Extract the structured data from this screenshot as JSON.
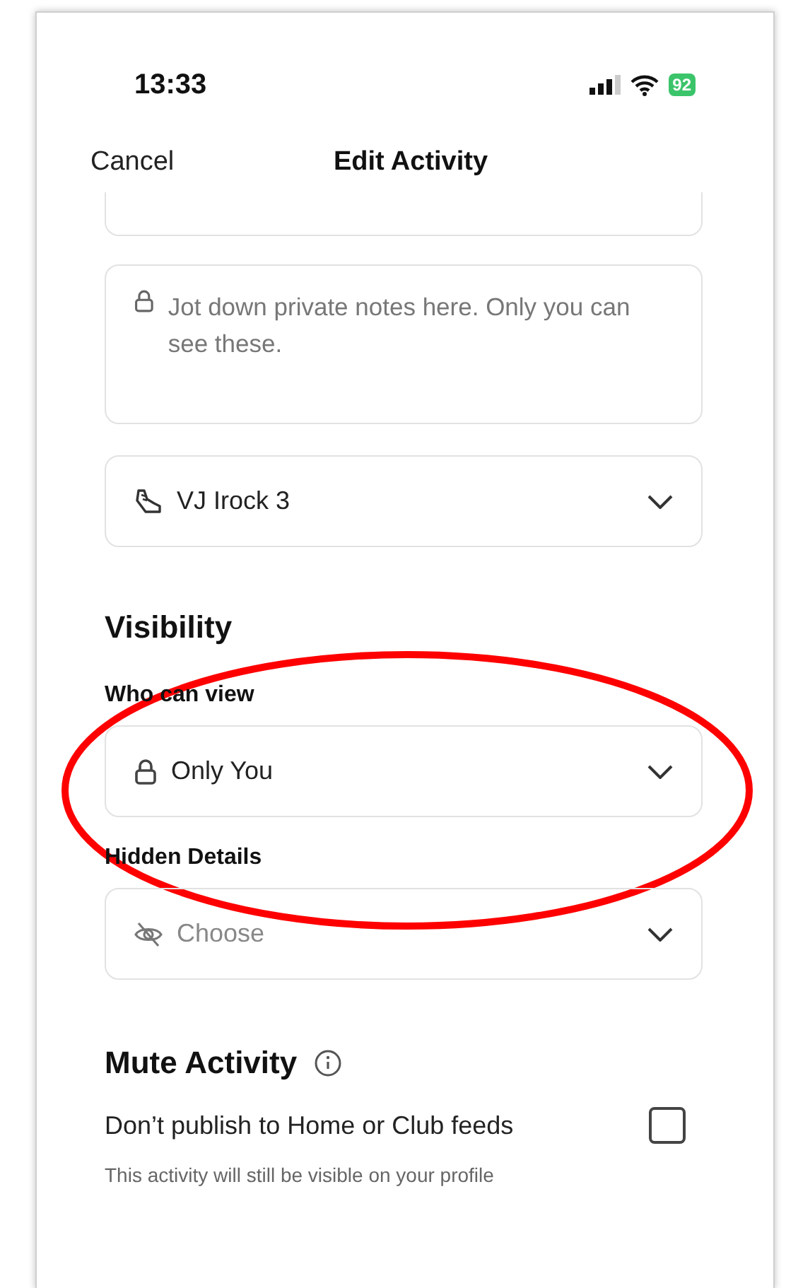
{
  "status_bar": {
    "time": "13:33",
    "battery": "92"
  },
  "nav": {
    "cancel": "Cancel",
    "title": "Edit Activity"
  },
  "notes": {
    "placeholder": "Jot down private notes here. Only you can see these."
  },
  "gear": {
    "value": "VJ Irock 3"
  },
  "visibility": {
    "heading": "Visibility",
    "fields": [
      {
        "label": "Who can view",
        "value": "Only You",
        "kind": "lock"
      },
      {
        "label": "Hidden Details",
        "placeholder": "Choose",
        "kind": "eye"
      }
    ]
  },
  "mute": {
    "heading": "Mute Activity",
    "option": "Don’t publish to Home or Club feeds",
    "checked": false,
    "note": "This activity will still be visible on your profile"
  },
  "annotation": {
    "kind": "ellipse",
    "color": "#ff0000"
  }
}
